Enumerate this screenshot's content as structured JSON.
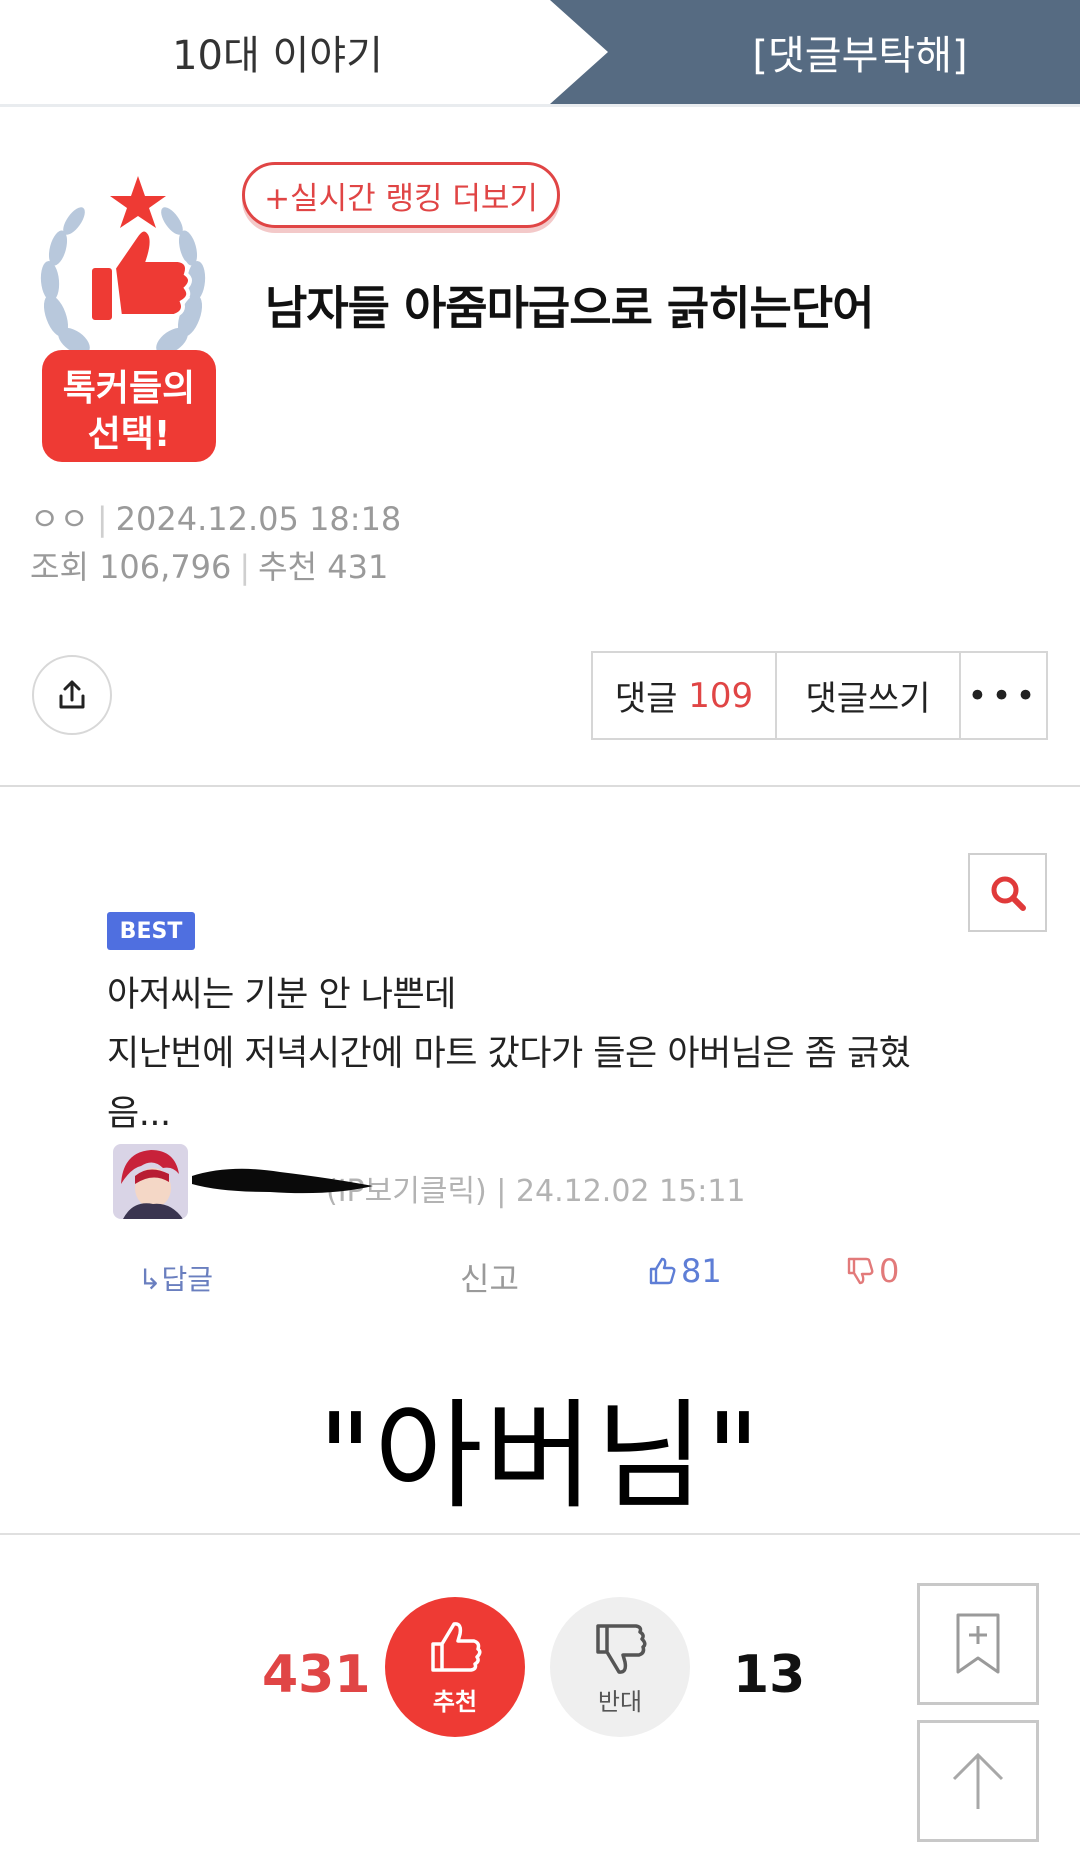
{
  "header": {
    "category": "10대 이야기",
    "subcategory": "[댓글부탁해]"
  },
  "badge": {
    "line1": "톡커들의",
    "line2": "선택!"
  },
  "post": {
    "ranking_more": "+실시간 랭킹 더보기",
    "title": "남자들 아줌마급으로 긁히는단어",
    "author": "ㅇㅇ",
    "datetime": "2024.12.05 18:18",
    "views_label": "조회",
    "views": "106,796",
    "recommend_label": "추천",
    "recommend": "431"
  },
  "actions": {
    "comment_label": "댓글",
    "comment_count": "109",
    "write_comment": "댓글쓰기",
    "more": "•••"
  },
  "comment": {
    "badge": "BEST",
    "lines": [
      "아저씨는 기분 안 나쁜데",
      "지난번에 저녁시간에 마트 갔다가 들은 아버님은 좀 긁혔",
      "음..."
    ],
    "meta": "(IP보기클릭) | 24.12.02 15:11",
    "reply": "↳답글",
    "report": "신고",
    "likes": "81",
    "dislikes": "0"
  },
  "image_caption": "\"아버님\"",
  "vote": {
    "recommend_count": "431",
    "recommend_label": "추천",
    "oppose_label": "반대",
    "oppose_count": "13"
  },
  "colors": {
    "accent_red": "#e04545",
    "header_blue": "#566b82",
    "best_blue": "#4f6fe0"
  }
}
